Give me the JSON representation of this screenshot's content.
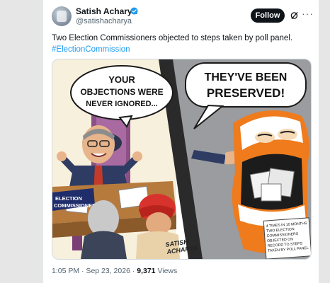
{
  "author": {
    "name": "Satish Acharya",
    "handle": "@satishacharya",
    "verified_color": "#1d9bf0"
  },
  "actions": {
    "follow_label": "Follow",
    "grok_icon": "grok-icon",
    "more_icon": "more-icon"
  },
  "tweet": {
    "text": "Two Election Commissioners objected to steps taken by poll panel.",
    "hashtag": "#ElectionCommission"
  },
  "cartoon": {
    "left_bubble": [
      "YOUR",
      "OBJECTIONS WERE",
      "NEVER IGNORED..."
    ],
    "right_bubble": [
      "THEY'VE BEEN",
      "PRESERVED!"
    ],
    "nameplate": [
      "ELECTION",
      "COMMISSIONER"
    ],
    "signature": [
      "SATISH",
      "ACHARYA"
    ],
    "note": [
      "4 TIMES IN 10 MONTHS",
      "TWO ELECTION",
      "COMMISSIONERS",
      "OBJECTED ON",
      "RECORD TO STEPS",
      "TAKEN BY POLL PANEL"
    ]
  },
  "meta": {
    "time": "1:05 PM · Sep 23, 2026 · ",
    "views_count": "9,371",
    "views_label": " Views"
  }
}
